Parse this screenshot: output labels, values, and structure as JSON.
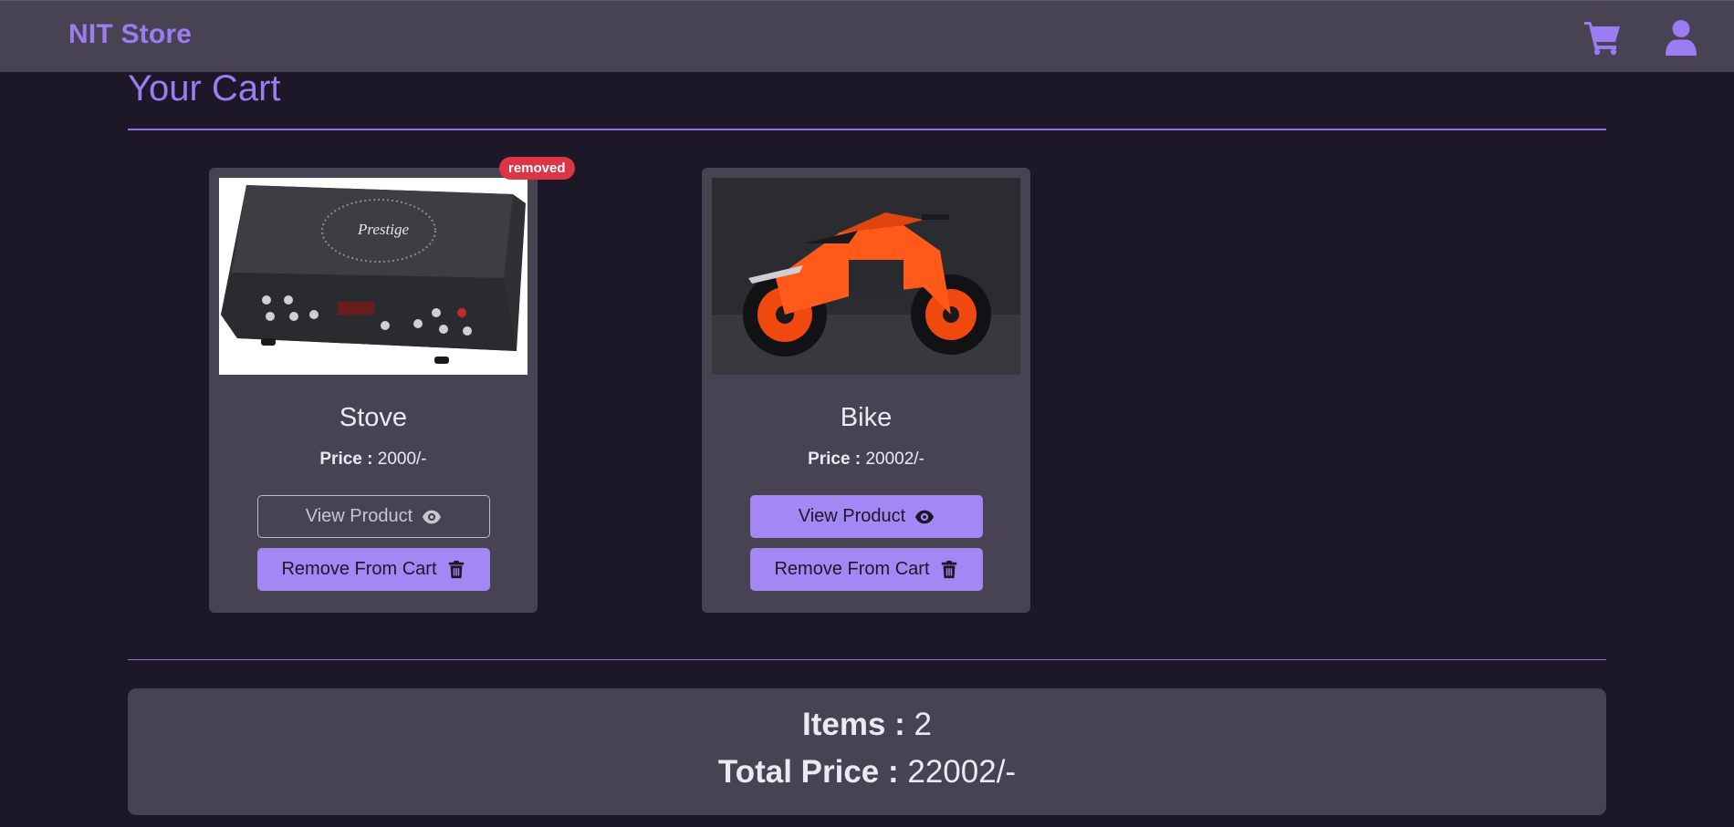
{
  "nav": {
    "brand": "NIT Store",
    "cart_icon": "shopping-cart-icon",
    "user_icon": "user-icon"
  },
  "page": {
    "title": "Your Cart"
  },
  "products": [
    {
      "name": "Stove",
      "image": "induction-stove-image",
      "price_label": "Price :",
      "price_value": "2000/-",
      "badge": "removed",
      "view_label": "View Product",
      "remove_label": "Remove From Cart"
    },
    {
      "name": "Bike",
      "image": "motorcycle-image",
      "price_label": "Price :",
      "price_value": "20002/-",
      "view_label": "View Product",
      "remove_label": "Remove From Cart"
    }
  ],
  "summary": {
    "items_label": "Items :",
    "items_value": "2",
    "total_label": "Total Price :",
    "total_value": "22002/-"
  },
  "colors": {
    "background": "#1c1827",
    "navbar": "#474352",
    "card": "#474352",
    "accent": "#9b7cf3",
    "button": "#a388f5",
    "badge": "#dc3545"
  }
}
